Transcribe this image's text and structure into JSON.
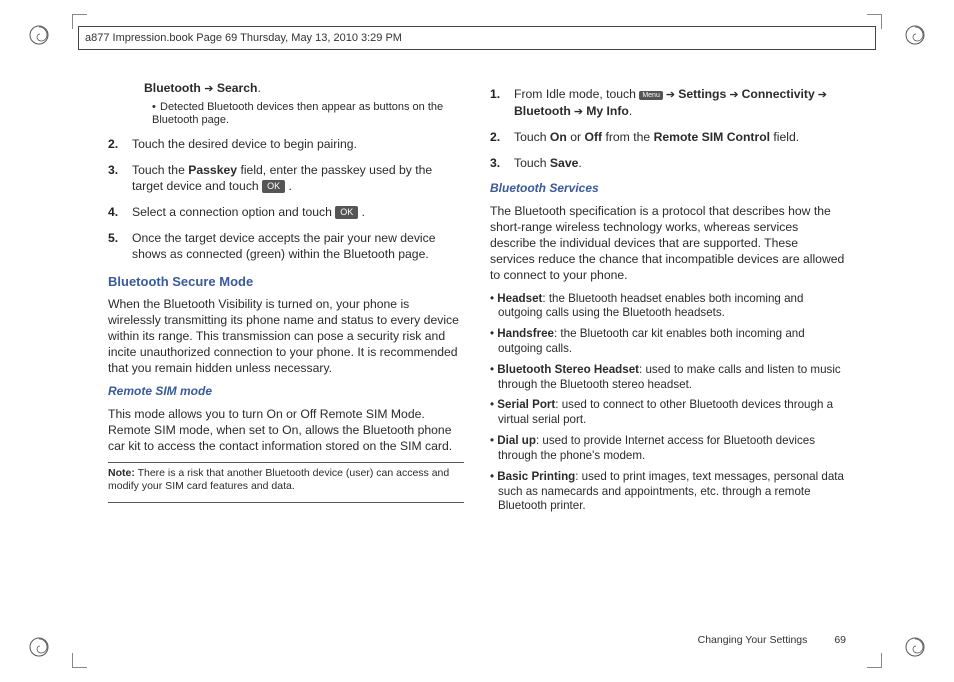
{
  "header": {
    "text": "a877 Impression.book  Page 69  Thursday, May 13, 2010  3:29 PM"
  },
  "left": {
    "lead_prefix": "Bluetooth ",
    "lead_arrow": "➔",
    "lead_suffix": " Search",
    "lead_period": ".",
    "sub_bullet": "Detected Bluetooth devices then appear as buttons on the Bluetooth page.",
    "items": [
      {
        "n": "2.",
        "body": "Touch the desired device to begin pairing."
      },
      {
        "n": "3.",
        "pre": "Touch the ",
        "b1": "Passkey",
        "mid": " field, enter the passkey used by the target device and touch ",
        "btn": "OK",
        "post": " ."
      },
      {
        "n": "4.",
        "pre": "Select a connection option and touch ",
        "btn": "OK",
        "post": " ."
      },
      {
        "n": "5.",
        "body": "Once the target device accepts the pair your new device shows as connected (green) within the Bluetooth page."
      }
    ],
    "h1": "Bluetooth Secure Mode",
    "p1": "When the Bluetooth Visibility is turned on, your phone is wirelessly transmitting its phone name and status to every device within its range. This transmission can pose a security risk and incite unauthorized connection to your phone. It is recommended that you remain hidden unless necessary.",
    "h2": "Remote SIM mode",
    "p2": "This mode allows you to turn On or Off Remote SIM Mode. Remote SIM mode, when set to On, allows the Bluetooth phone car kit to access the contact information stored on the SIM card.",
    "note_label": "Note:",
    "note_body": " There is a risk that another Bluetooth device (user) can access and modify your SIM card features and data."
  },
  "right": {
    "items": [
      {
        "n": "1.",
        "pre": "From Idle mode, touch ",
        "menu_btn": "Menu",
        "arrow": " ➔ ",
        "seq": [
          "Settings",
          "Connectivity",
          "Bluetooth",
          "My Info"
        ],
        "post": "."
      },
      {
        "n": "2.",
        "pre": "Touch ",
        "b1": "On",
        "mid1": " or ",
        "b2": "Off",
        "mid2": " from the ",
        "b3": "Remote SIM Control",
        "post": " field."
      },
      {
        "n": "3.",
        "pre": "Touch ",
        "b1": "Save",
        "post": "."
      }
    ],
    "h1": "Bluetooth Services",
    "p1": "The Bluetooth specification is a protocol that describes how the short-range wireless technology works, whereas services describe the individual devices that are supported. These services reduce the chance that incompatible devices are allowed to connect to your phone.",
    "services": [
      {
        "b": "Headset",
        "t": ": the Bluetooth headset enables both incoming and outgoing calls using the Bluetooth headsets."
      },
      {
        "b": "Handsfree",
        "t": ": the Bluetooth car kit enables both incoming and outgoing calls."
      },
      {
        "b": "Bluetooth Stereo Headset",
        "t": ": used to make calls and listen to music through the Bluetooth stereo headset."
      },
      {
        "b": "Serial Port",
        "t": ": used to connect to other Bluetooth devices through a virtual serial port."
      },
      {
        "b": "Dial up",
        "t": ": used to provide Internet access for Bluetooth devices through the phone's modem."
      },
      {
        "b": "Basic Printing",
        "t": ": used to print images, text messages, personal data such as namecards and appointments, etc. through a remote Bluetooth printer."
      }
    ]
  },
  "footer": {
    "title": "Changing Your Settings",
    "page": "69"
  }
}
